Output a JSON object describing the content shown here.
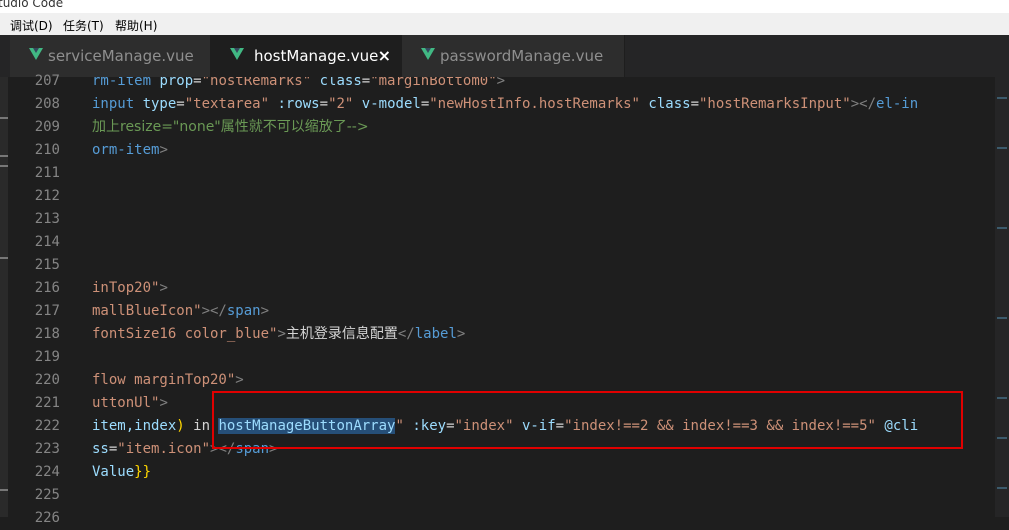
{
  "window": {
    "title": "tudio Code"
  },
  "menu": [
    "调试(D)",
    "任务(T)",
    "帮助(H)"
  ],
  "tabs": [
    {
      "label": "serviceManage.vue",
      "active": false
    },
    {
      "label": "hostManage.vue",
      "active": true,
      "close": "×"
    },
    {
      "label": "passwordManage.vue",
      "active": false
    }
  ],
  "line_numbers": [
    "207",
    "208",
    "209",
    "210",
    "211",
    "212",
    "213",
    "214",
    "215",
    "216",
    "217",
    "218",
    "219",
    "220",
    "221",
    "222",
    "223",
    "224",
    "225",
    "226"
  ],
  "code_lines": [
    {
      "segments": [
        {
          "t": "rm-item ",
          "c": "t-tag"
        },
        {
          "t": "prop",
          "c": "t-attr"
        },
        {
          "t": "=",
          "c": ""
        },
        {
          "t": "\"hostRemarks\"",
          "c": "t-str"
        },
        {
          "t": " ",
          "c": ""
        },
        {
          "t": "class",
          "c": "t-attr"
        },
        {
          "t": "=",
          "c": ""
        },
        {
          "t": "\"marginBottom0\"",
          "c": "t-str"
        },
        {
          "t": ">",
          "c": "t-pun"
        }
      ]
    },
    {
      "segments": [
        {
          "t": "input ",
          "c": "t-tag"
        },
        {
          "t": "type",
          "c": "t-attr"
        },
        {
          "t": "=",
          "c": ""
        },
        {
          "t": "\"textarea\"",
          "c": "t-str"
        },
        {
          "t": " ",
          "c": ""
        },
        {
          "t": ":rows",
          "c": "t-attr"
        },
        {
          "t": "=",
          "c": ""
        },
        {
          "t": "\"2\"",
          "c": "t-str"
        },
        {
          "t": " ",
          "c": ""
        },
        {
          "t": "v-model",
          "c": "t-attr"
        },
        {
          "t": "=",
          "c": ""
        },
        {
          "t": "\"newHostInfo.hostRemarks\"",
          "c": "t-str"
        },
        {
          "t": " ",
          "c": ""
        },
        {
          "t": "class",
          "c": "t-attr"
        },
        {
          "t": "=",
          "c": ""
        },
        {
          "t": "\"hostRemarksInput\"",
          "c": "t-str"
        },
        {
          "t": "></",
          "c": "t-pun"
        },
        {
          "t": "el-in",
          "c": "t-tag"
        }
      ]
    },
    {
      "segments": [
        {
          "t": "加上resize=\"none\"属性就不可以缩放了-->",
          "c": "t-cmt"
        }
      ]
    },
    {
      "segments": [
        {
          "t": "orm-item",
          "c": "t-tag"
        },
        {
          "t": ">",
          "c": "t-pun"
        }
      ]
    },
    {
      "segments": []
    },
    {
      "segments": []
    },
    {
      "segments": []
    },
    {
      "segments": []
    },
    {
      "segments": []
    },
    {
      "segments": [
        {
          "t": "inTop20\"",
          "c": "t-str"
        },
        {
          "t": ">",
          "c": "t-pun"
        }
      ]
    },
    {
      "segments": [
        {
          "t": "mallBlueIcon\"",
          "c": "t-str"
        },
        {
          "t": "></",
          "c": "t-pun"
        },
        {
          "t": "span",
          "c": "t-tag"
        },
        {
          "t": ">",
          "c": "t-pun"
        }
      ]
    },
    {
      "segments": [
        {
          "t": "fontSize16 color_blue\"",
          "c": "t-str"
        },
        {
          "t": ">",
          "c": "t-pun"
        },
        {
          "t": "主机登录信息配置",
          "c": ""
        },
        {
          "t": "</",
          "c": "t-pun"
        },
        {
          "t": "label",
          "c": "t-tag"
        },
        {
          "t": ">",
          "c": "t-pun"
        }
      ]
    },
    {
      "segments": []
    },
    {
      "segments": [
        {
          "t": "flow marginTop20\"",
          "c": "t-str"
        },
        {
          "t": ">",
          "c": "t-pun"
        }
      ]
    },
    {
      "segments": [
        {
          "t": "uttonUl\"",
          "c": "t-str"
        },
        {
          "t": ">",
          "c": "t-pun"
        }
      ]
    },
    {
      "segments": [
        {
          "t": "item,index",
          "c": "t-attr"
        },
        {
          "t": ")",
          "c": "t-br"
        },
        {
          "t": " in ",
          "c": ""
        },
        {
          "t": "hostManageButtonArray",
          "c": "t-attr t-sel"
        },
        {
          "t": "\"",
          "c": "t-str"
        },
        {
          "t": " ",
          "c": ""
        },
        {
          "t": ":key",
          "c": "t-attr"
        },
        {
          "t": "=",
          "c": ""
        },
        {
          "t": "\"index\"",
          "c": "t-str"
        },
        {
          "t": " ",
          "c": ""
        },
        {
          "t": "v-if",
          "c": "t-attr"
        },
        {
          "t": "=",
          "c": ""
        },
        {
          "t": "\"index!==2 && index!==3 && index!==5\"",
          "c": "t-str"
        },
        {
          "t": " ",
          "c": ""
        },
        {
          "t": "@cli",
          "c": "t-attr"
        }
      ]
    },
    {
      "segments": [
        {
          "t": "ss",
          "c": "t-attr"
        },
        {
          "t": "=",
          "c": ""
        },
        {
          "t": "\"item.icon\"",
          "c": "t-str"
        },
        {
          "t": "></",
          "c": "t-pun"
        },
        {
          "t": "span",
          "c": "t-tag"
        },
        {
          "t": ">",
          "c": "t-pun"
        }
      ]
    },
    {
      "segments": [
        {
          "t": "Value",
          "c": "t-attr"
        },
        {
          "t": "}}",
          "c": "t-br"
        }
      ]
    },
    {
      "segments": []
    },
    {
      "segments": []
    }
  ],
  "colors": {
    "editor_bg": "#1e1e1e",
    "highlight_box": "#e00000",
    "vue_icon": "#41b883"
  }
}
